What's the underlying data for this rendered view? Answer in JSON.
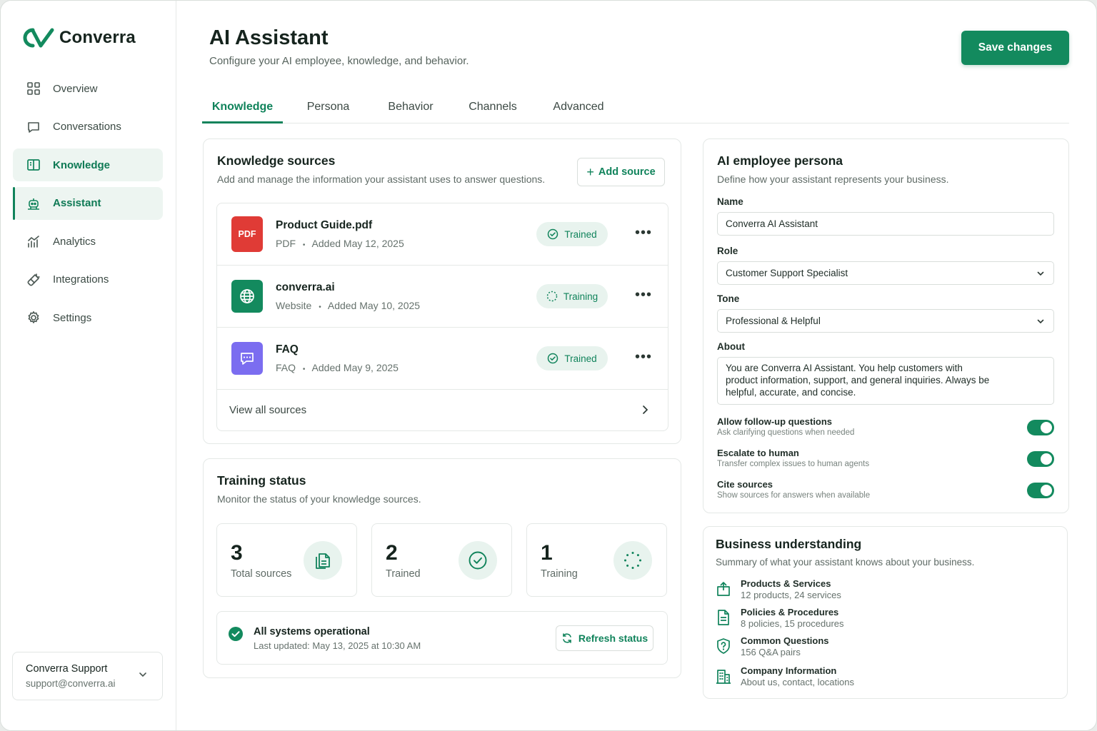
{
  "brand": {
    "name": "Converra"
  },
  "sidebar": {
    "items": [
      {
        "label": "Overview",
        "icon": "grid-icon"
      },
      {
        "label": "Conversations",
        "icon": "chat-icon"
      },
      {
        "label": "Knowledge",
        "icon": "book-icon"
      },
      {
        "label": "Assistant",
        "icon": "robot-icon"
      },
      {
        "label": "Analytics",
        "icon": "chart-icon"
      },
      {
        "label": "Integrations",
        "icon": "plug-icon"
      },
      {
        "label": "Settings",
        "icon": "gear-icon"
      }
    ],
    "account": {
      "name": "Converra Support",
      "email": "support@converra.ai"
    }
  },
  "header": {
    "title": "AI Assistant",
    "subtitle": "Configure your AI employee, knowledge, and behavior.",
    "save_label": "Save changes"
  },
  "tabs": [
    "Knowledge",
    "Persona",
    "Behavior",
    "Channels",
    "Advanced"
  ],
  "knowledge": {
    "title": "Knowledge sources",
    "subtitle": "Add and manage the information your assistant uses to answer questions.",
    "add_label": "Add source",
    "sources": [
      {
        "name": "Product Guide.pdf",
        "type": "PDF",
        "added": "Added May 12, 2025",
        "status": "Trained",
        "icon_text": "PDF"
      },
      {
        "name": "converra.ai",
        "type": "Website",
        "added": "Added May 10, 2025",
        "status": "Training"
      },
      {
        "name": "FAQ",
        "type": "FAQ",
        "added": "Added May 9, 2025",
        "status": "Trained"
      }
    ],
    "view_all": "View all sources",
    "separator": "•",
    "more": "•••"
  },
  "training": {
    "title": "Training status",
    "subtitle": "Monitor the status of your knowledge sources.",
    "stats": [
      {
        "value": "3",
        "label": "Total sources"
      },
      {
        "value": "2",
        "label": "Trained"
      },
      {
        "value": "1",
        "label": "Training"
      }
    ],
    "system_title": "All systems operational",
    "system_sub": "Last updated: May 13, 2025 at 10:30 AM",
    "refresh_label": "Refresh status"
  },
  "persona": {
    "title": "AI employee persona",
    "subtitle": "Define how your assistant represents your business.",
    "name_label": "Name",
    "name_value": "Converra AI Assistant",
    "role_label": "Role",
    "role_value": "Customer Support Specialist",
    "tone_label": "Tone",
    "tone_value": "Professional & Helpful",
    "about_label": "About",
    "about_value": "You are Converra AI Assistant. You help customers with product information, support, and general inquiries. Always be helpful, accurate, and concise.",
    "toggles": [
      {
        "title": "Allow follow-up questions",
        "sub": "Ask clarifying questions when needed",
        "on": true
      },
      {
        "title": "Escalate to human",
        "sub": "Transfer complex issues to human agents",
        "on": true
      },
      {
        "title": "Cite sources",
        "sub": "Show sources for answers when available",
        "on": true
      }
    ]
  },
  "business": {
    "title": "Business understanding",
    "subtitle": "Summary of what your assistant knows about your business.",
    "items": [
      {
        "title": "Products & Services",
        "sub": "12 products, 24 services"
      },
      {
        "title": "Policies & Procedures",
        "sub": "8 policies, 15 procedures"
      },
      {
        "title": "Common Questions",
        "sub": "156 Q&A pairs"
      },
      {
        "title": "Company Information",
        "sub": "About us, contact, locations"
      }
    ]
  },
  "colors": {
    "accent": "#138a5e",
    "accent_soft": "#e8f3ee",
    "pdf": "#e03b36",
    "web": "#138a5e",
    "faq": "#7b6df0"
  }
}
